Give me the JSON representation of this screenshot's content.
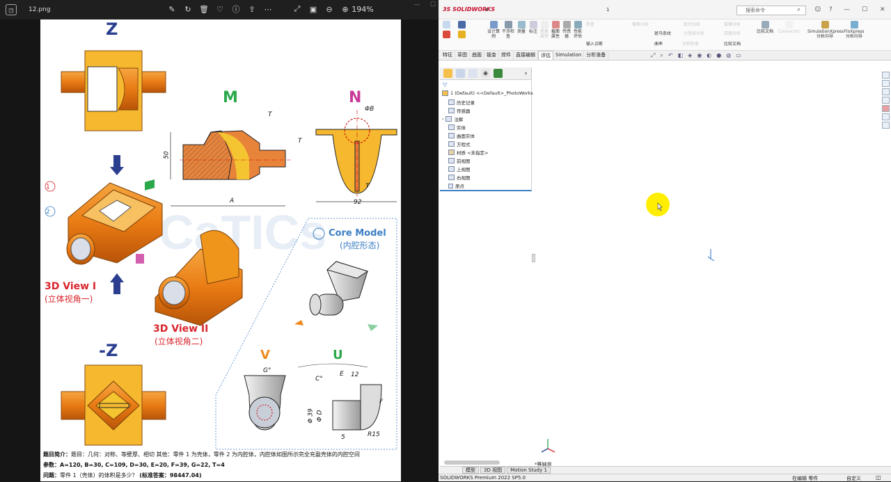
{
  "viewer": {
    "filename": "12.png",
    "zoom": "194%"
  },
  "drawing": {
    "z": "Z",
    "neg_z": "-Z",
    "m": "M",
    "n": "N",
    "v": "V",
    "u": "U",
    "core_model": "Core Model",
    "core_model_cn": "(内腔形态)",
    "view1": "3D View I",
    "view1_cn": "(立体视角一)",
    "view2": "3D View II",
    "view2_cn": "(立体视角二)",
    "dim_50": "50",
    "dim_A": "A",
    "dim_T": "T",
    "dim_92": "92",
    "dim_phiB": "ΦB",
    "dim_G": "G°",
    "dim_C": "C°",
    "dim_E": "E",
    "dim_12": "12",
    "dim_F": "F",
    "dim_phi39": "Φ 39",
    "dim_phiD": "Φ D",
    "dim_5": "5",
    "dim_R15": "R15",
    "callout1": "1",
    "callout2": "2",
    "watermark": "CaTICs",
    "intro_label": "题目简介：",
    "intro_text": "题目：几何：对称、等壁厚、相切 其他：零件 1 为壳体，零件 2 为内腔体，内腔体如图所示完全充盈壳体的内腔空间",
    "params_label": "参数：",
    "params": "A=120,   B=30,   C=109,   D=30,   E=20,   F=39,   G=22,   T=4",
    "question_label": "问题：",
    "question": "零件 1（壳体）的体积是多少？",
    "answer": "(标准答案：98447.04)"
  },
  "sw": {
    "logo": "3S SOLIDWORKS",
    "doc_title": "1",
    "search_placeholder": "搜索命令",
    "ribbon": {
      "design_study": "设计算例",
      "interference": "干涉检查",
      "measure": "测量",
      "markup": "标注",
      "mass_props": "质量属性",
      "section_props": "截面属性",
      "sensor": "传感器",
      "perf_eval": "性能评估",
      "check": "检查",
      "import_diag": "输入诊断",
      "deviation": "偏差分析",
      "zebra": "斑马条纹",
      "curvature": "曲率",
      "compare_docs": "比较文档",
      "compare_docs2": "比较文档",
      "undercut": "底切分析",
      "parting": "分型线分析",
      "draft": "拔模分析",
      "thickness": "厚度分析",
      "symmetry": "对称检查",
      "simulation": "SimulationXpress 分析向导",
      "floxpress": "FloXpress 分析向导",
      "connector": "Connector"
    },
    "tabs": [
      "特征",
      "草图",
      "曲面",
      "钣金",
      "焊件",
      "直接编辑",
      "评估",
      "Simulation",
      "分析准备"
    ],
    "tree": [
      "1 (Default) <<Default>_PhotoWorks",
      "历史记录",
      "传感器",
      "注解",
      "实体",
      "曲面实体",
      "方程式",
      "材质 <未指定>",
      "前视图",
      "上视图",
      "右视图",
      "原点"
    ],
    "view_label": "*等轴测",
    "bottom_tabs": [
      "模型",
      "3D 视图",
      "Motion Study 1"
    ],
    "status_left": "SOLIDWORKS Premium 2022 SP5.0",
    "status_mid": "在编辑 零件",
    "status_right": "自定义"
  },
  "colors": {
    "orange": "#f08a1e",
    "dark_orange": "#c8600a",
    "blue": "#2b3e8f",
    "green": "#2aa84a",
    "magenta": "#c8389a",
    "red": "#d8242c",
    "cursor": "#ffee00"
  }
}
